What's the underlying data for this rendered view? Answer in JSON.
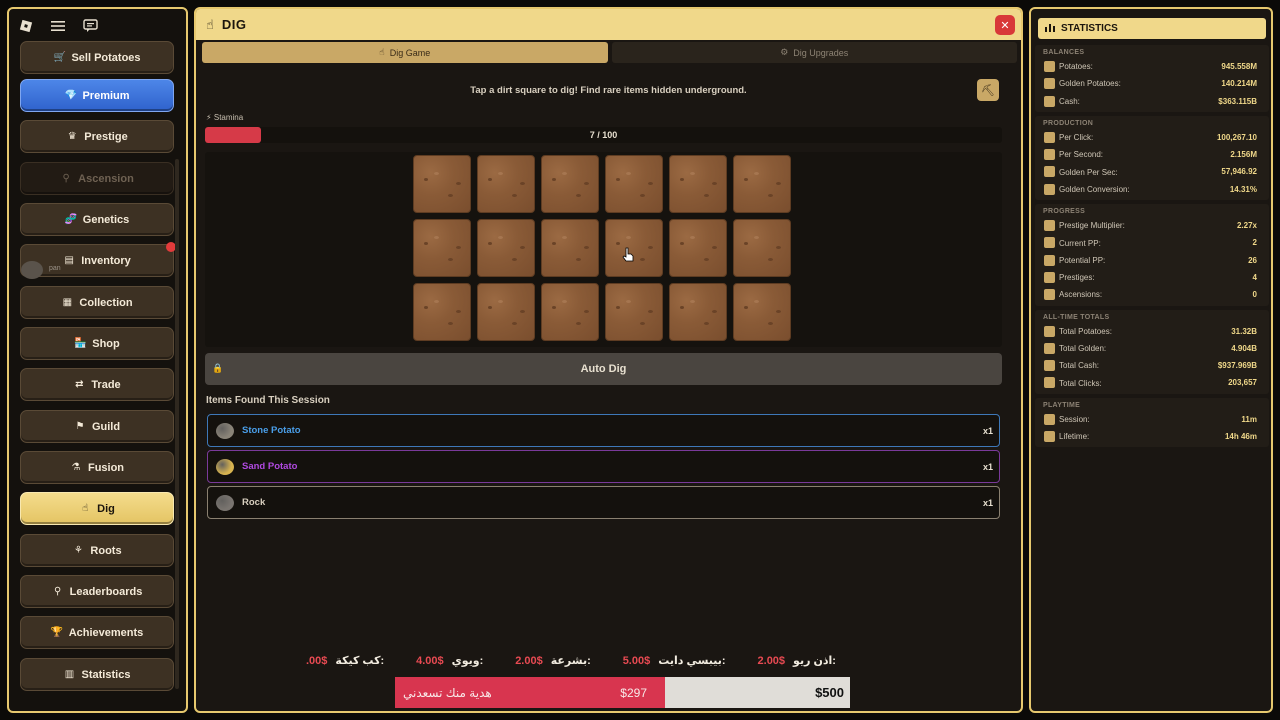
{
  "sidebar": {
    "avatar_name": "pan",
    "items": [
      {
        "label": "Sell Potatoes",
        "icon": "🛒",
        "style": "partial"
      },
      {
        "label": "Premium",
        "icon": "💎",
        "style": "premium"
      },
      {
        "label": "Prestige",
        "icon": "♛",
        "style": "normal"
      },
      {
        "label": "Ascension",
        "icon": "⚲",
        "style": "locked"
      },
      {
        "label": "Genetics",
        "icon": "🧬",
        "style": "normal"
      },
      {
        "label": "Inventory",
        "icon": "▤",
        "style": "normal"
      },
      {
        "label": "Collection",
        "icon": "▦",
        "style": "normal"
      },
      {
        "label": "Shop",
        "icon": "🏪",
        "style": "normal"
      },
      {
        "label": "Trade",
        "icon": "⇄",
        "style": "normal"
      },
      {
        "label": "Guild",
        "icon": "⚑",
        "style": "normal"
      },
      {
        "label": "Fusion",
        "icon": "⚗",
        "style": "normal"
      },
      {
        "label": "Dig",
        "icon": "☝",
        "style": "active"
      },
      {
        "label": "Roots",
        "icon": "⚘",
        "style": "normal"
      },
      {
        "label": "Leaderboards",
        "icon": "⚲",
        "style": "normal"
      },
      {
        "label": "Achievements",
        "icon": "🏆",
        "style": "normal"
      },
      {
        "label": "Statistics",
        "icon": "▥",
        "style": "normal"
      }
    ]
  },
  "main": {
    "title": "DIG",
    "tabs": [
      {
        "label": "Dig Game",
        "active": true
      },
      {
        "label": "Dig Upgrades",
        "active": false
      }
    ],
    "hint": "Tap a dirt square to dig! Find rare items hidden underground.",
    "stamina": {
      "label": "Stamina",
      "current": 7,
      "max": 100,
      "text": "7 / 100"
    },
    "grid": {
      "rows": 3,
      "cols": 6
    },
    "auto_dig_label": "Auto Dig",
    "found_title": "Items Found This Session",
    "found_items": [
      {
        "name": "Stone Potato",
        "count": "x1",
        "color": "#4a9ee8",
        "border": "#3e78b8",
        "gem": "#8a8478"
      },
      {
        "name": "Sand Potato",
        "count": "x1",
        "color": "#b04ae0",
        "border": "#7a3a9a",
        "gem": "#d8b450"
      },
      {
        "name": "Rock",
        "count": "x1",
        "color": "#d8cfbf",
        "border": "#8a8070",
        "gem": "#7a7570"
      }
    ]
  },
  "ticker": [
    {
      "name": "كب كيكة:",
      "price": ".00$"
    },
    {
      "name": "ويوي:",
      "price": "4.00$"
    },
    {
      "name": "بشرعة:",
      "price": "2.00$"
    },
    {
      "name": "بيبسي دايت:",
      "price": "5.00$"
    },
    {
      "name": "اذن ريو:",
      "price": "2.00$"
    }
  ],
  "donate": {
    "left_text": "هدية منك تسعدني",
    "left_amount": "$297",
    "right_amount": "$500"
  },
  "stats": {
    "title": "STATISTICS",
    "sections": [
      {
        "title": "BALANCES",
        "rows": [
          {
            "label": "Potatoes:",
            "value": "945.558M"
          },
          {
            "label": "Golden Potatoes:",
            "value": "140.214M"
          },
          {
            "label": "Cash:",
            "value": "$363.115B"
          }
        ]
      },
      {
        "title": "PRODUCTION",
        "rows": [
          {
            "label": "Per Click:",
            "value": "100,267.10"
          },
          {
            "label": "Per Second:",
            "value": "2.156M"
          },
          {
            "label": "Golden Per Sec:",
            "value": "57,946.92"
          },
          {
            "label": "Golden Conversion:",
            "value": "14.31%"
          }
        ]
      },
      {
        "title": "PROGRESS",
        "rows": [
          {
            "label": "Prestige Multiplier:",
            "value": "2.27x"
          },
          {
            "label": "Current PP:",
            "value": "2"
          },
          {
            "label": "Potential PP:",
            "value": "26"
          },
          {
            "label": "Prestiges:",
            "value": "4"
          },
          {
            "label": "Ascensions:",
            "value": "0"
          }
        ]
      },
      {
        "title": "ALL-TIME TOTALS",
        "rows": [
          {
            "label": "Total Potatoes:",
            "value": "31.32B"
          },
          {
            "label": "Total Golden:",
            "value": "4.904B"
          },
          {
            "label": "Total Cash:",
            "value": "$937.969B"
          },
          {
            "label": "Total Clicks:",
            "value": "203,657"
          }
        ]
      },
      {
        "title": "PLAYTIME",
        "rows": [
          {
            "label": "Session:",
            "value": "11m"
          },
          {
            "label": "Lifetime:",
            "value": "14h 46m"
          }
        ]
      }
    ]
  },
  "colors": {
    "accent": "#e6c86e",
    "header": "#f0d88a",
    "premium": "#3a6fd8",
    "stamina": "#d63a48",
    "dirt": "#8a5b37"
  }
}
